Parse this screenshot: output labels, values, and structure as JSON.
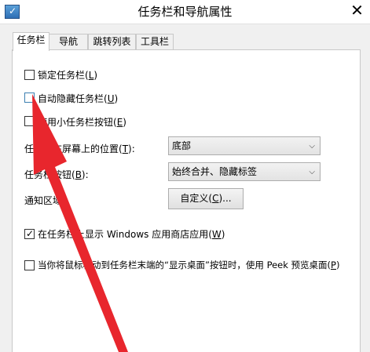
{
  "window": {
    "title": "任务栏和导航属性",
    "close_label": "✕"
  },
  "tabs": [
    {
      "label": "任务栏",
      "active": true
    },
    {
      "label": "导航",
      "active": false
    },
    {
      "label": "跳转列表",
      "active": false
    },
    {
      "label": "工具栏",
      "active": false
    }
  ],
  "options": {
    "lock_taskbar": {
      "pre": "锁定任务栏(",
      "key": "L",
      "post": ")",
      "checked": false
    },
    "auto_hide": {
      "pre": "自动隐藏任务栏(",
      "key": "U",
      "post": ")",
      "checked": false
    },
    "small_buttons": {
      "pre": "使用小任务栏按钮(",
      "key": "E",
      "post": ")",
      "checked": false
    },
    "show_store_apps": {
      "pre": "在任务栏上显示 Windows 应用商店应用(",
      "key": "W",
      "post": ")",
      "checked": true
    },
    "peek": {
      "pre": "当你将鼠标移动到任务栏末端的“显示桌面”按钮时，使用 Peek 预览桌面(",
      "key": "P",
      "post": ")",
      "checked": false
    }
  },
  "position_field": {
    "label_pre": "任务栏在屏幕上的位置(",
    "key": "T",
    "label_post": "):",
    "value": "底部"
  },
  "buttons_field": {
    "label_pre": "任务栏按钮(",
    "key": "B",
    "label_post": "):",
    "value": "始终合并、隐藏标签"
  },
  "notify_area": {
    "label": "通知区域:",
    "button_pre": "自定义(",
    "button_key": "C",
    "button_post": ")..."
  },
  "annotation": {
    "arrow_color": "#e8262d"
  },
  "icons": {
    "app_icon": "taskbar-properties-icon",
    "dropdown": "chevron-down-icon"
  }
}
